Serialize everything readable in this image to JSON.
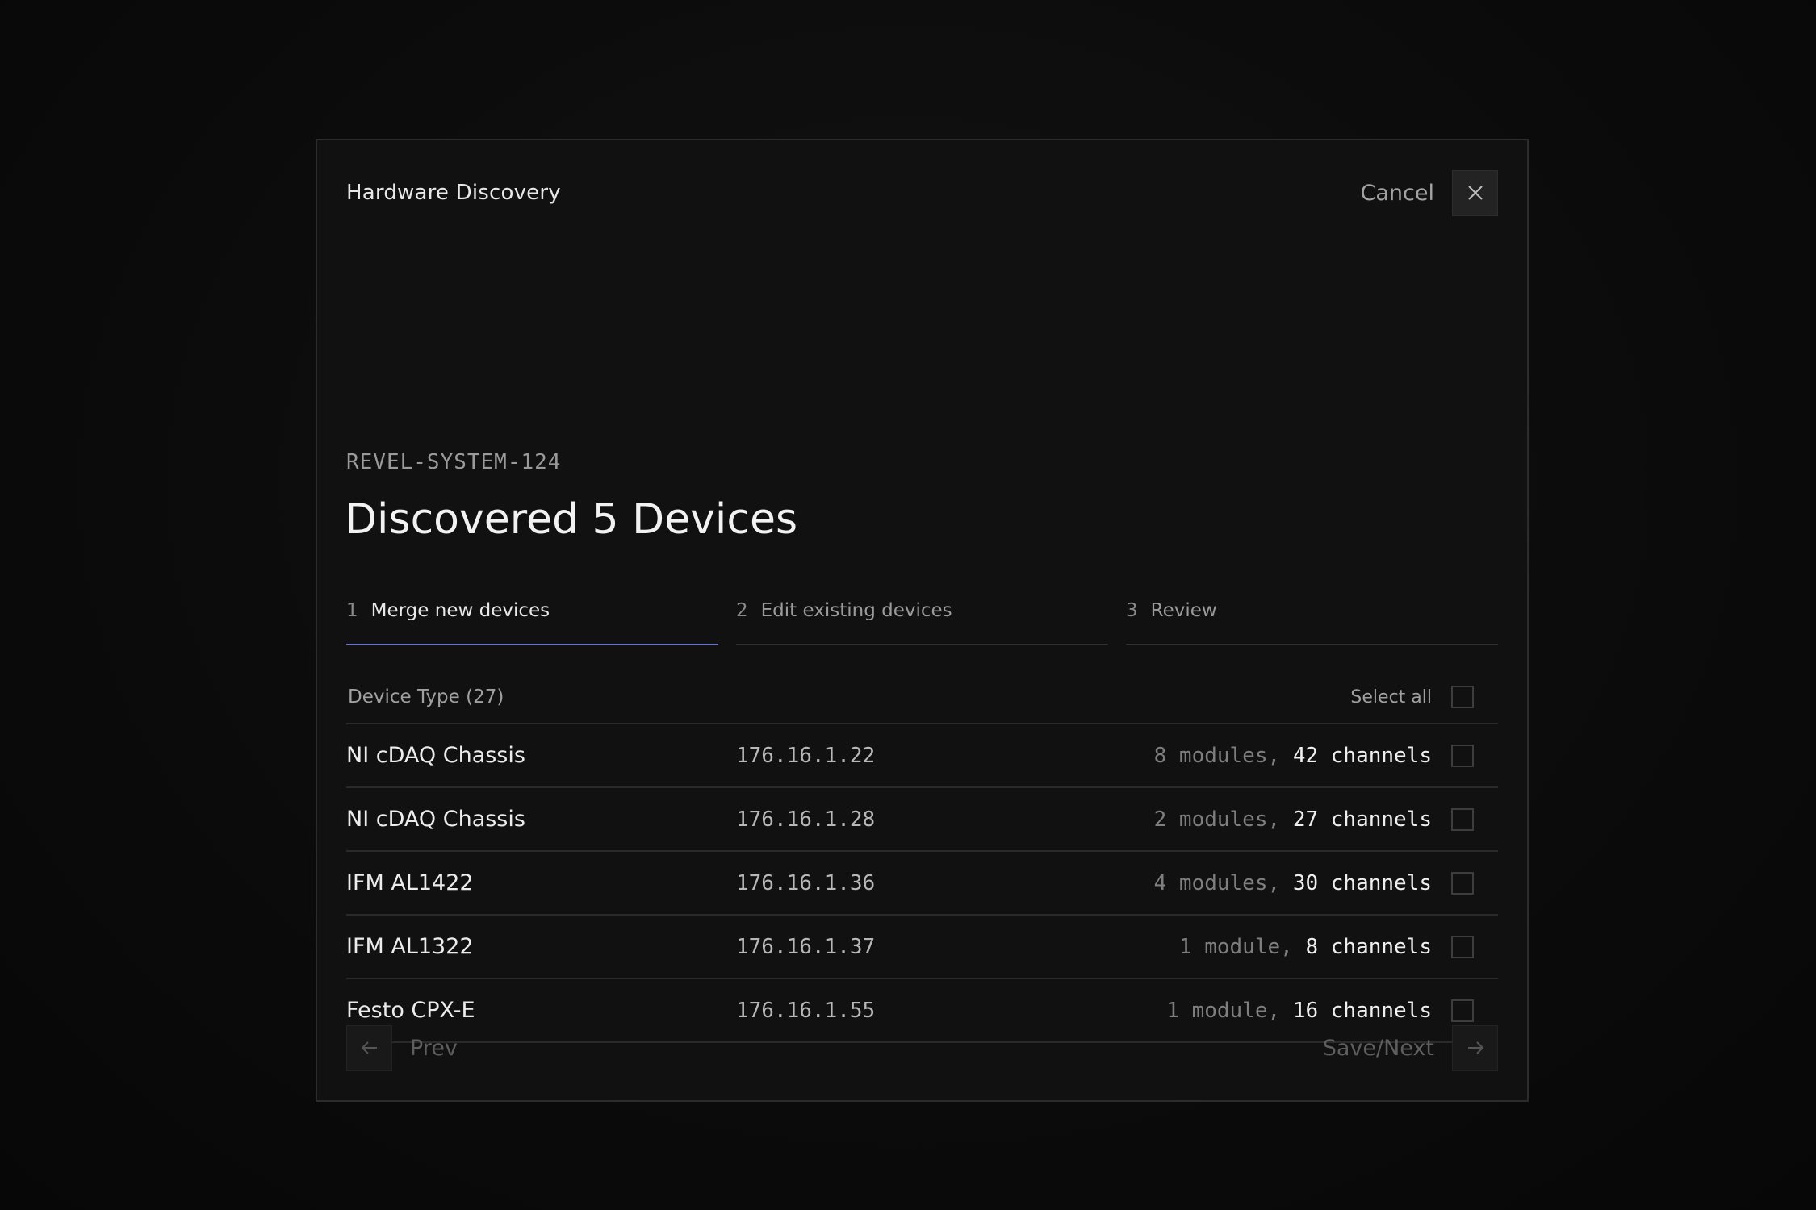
{
  "dialog": {
    "title": "Hardware Discovery",
    "cancel_label": "Cancel"
  },
  "system_id": "REVEL-SYSTEM-124",
  "heading": "Discovered 5 Devices",
  "steps": [
    {
      "number": "1",
      "label": "Merge new devices",
      "active": true
    },
    {
      "number": "2",
      "label": "Edit existing devices",
      "active": false
    },
    {
      "number": "3",
      "label": "Review",
      "active": false
    }
  ],
  "table": {
    "column_label": "Device Type (27)",
    "select_all_label": "Select all",
    "rows": [
      {
        "name": "NI cDAQ Chassis",
        "ip": "176.16.1.22",
        "modules": "8 modules,",
        "channels": "42 channels"
      },
      {
        "name": "NI cDAQ Chassis",
        "ip": "176.16.1.28",
        "modules": "2 modules,",
        "channels": "27 channels"
      },
      {
        "name": "IFM AL1422",
        "ip": "176.16.1.36",
        "modules": "4 modules,",
        "channels": "30 channels"
      },
      {
        "name": "IFM AL1322",
        "ip": "176.16.1.37",
        "modules": "1 module,",
        "channels": "8 channels"
      },
      {
        "name": "Festo CPX-E",
        "ip": "176.16.1.55",
        "modules": "1 module,",
        "channels": "16 channels"
      }
    ]
  },
  "footer": {
    "prev_label": "Prev",
    "next_label": "Save/Next"
  },
  "colors": {
    "accent": "#6b75c7",
    "background": "#111111"
  },
  "icons": {
    "close": "close-icon",
    "prev": "arrow-left-icon",
    "next": "arrow-right-icon"
  }
}
